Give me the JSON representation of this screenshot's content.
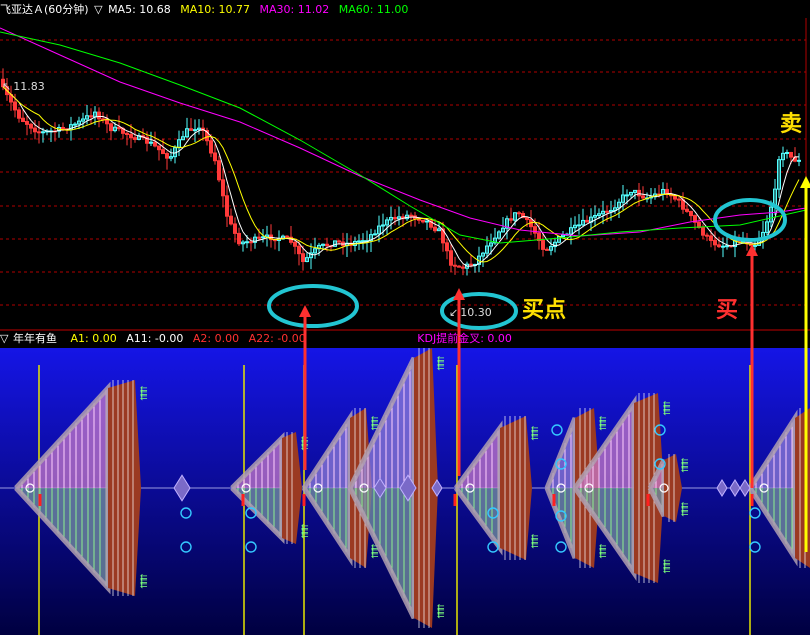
{
  "top_panel": {
    "symbol": "飞亚达Ａ(60分钟)",
    "toggle_icon": "triangle-down-icon",
    "ma_indicators": [
      {
        "label": "MA5: 10.68",
        "color": "#ffffff"
      },
      {
        "label": "MA10: 10.77",
        "color": "#ffff00"
      },
      {
        "label": "MA30: 11.02",
        "color": "#ff00ff"
      },
      {
        "label": "MA60: 11.00",
        "color": "#00ff00"
      }
    ],
    "high_label": "11.83",
    "low_label": "10.30"
  },
  "bottom_panel": {
    "title": "年年有鱼",
    "indicators": [
      {
        "label": "A1: 0.00",
        "color": "#ffff00"
      },
      {
        "label": "A11: -0.00",
        "color": "#ffffff"
      },
      {
        "label": "A2: 0.00",
        "color": "#ff3030"
      },
      {
        "label": "A22: -0.00",
        "color": "#ff3030"
      },
      {
        "label": "KDJ提前金叉: 0.00",
        "color": "#ff00ff"
      }
    ]
  },
  "annotations": {
    "buy_point": "买点",
    "buy": "买",
    "sell": "卖"
  },
  "colors": {
    "up_candle": "#54ffff",
    "down_candle": "#ff3a3a",
    "ma5": "#ffffff",
    "ma10": "#ffff00",
    "ma30": "#ff00ff",
    "ma60": "#00ff00",
    "grid": "#b00000",
    "circle_highlight": "#22c5d2",
    "arrow_buy": "#ff3030",
    "arrow_sell": "#ffff00",
    "indicator_bg_top": "#1515e6",
    "indicator_bg_bottom": "#000040"
  },
  "chart_data": [
    {
      "type": "candlestick",
      "title": "飞亚达Ａ(60分钟)",
      "ylim": [
        10.1,
        12.2
      ],
      "price_labels": [
        11.83,
        10.3
      ],
      "series": [
        {
          "name": "MA5",
          "last": 10.68
        },
        {
          "name": "MA10",
          "last": 10.77
        },
        {
          "name": "MA30",
          "last": 11.02
        },
        {
          "name": "MA60",
          "last": 11.0
        }
      ],
      "highlighted_lows": [
        10.44,
        10.3,
        10.56
      ],
      "signals": [
        "买点",
        "买",
        "卖"
      ]
    },
    {
      "type": "indicator",
      "title": "年年有鱼",
      "values": [
        {
          "name": "A1",
          "value": 0.0
        },
        {
          "name": "A11",
          "value": -0.0
        },
        {
          "name": "A2",
          "value": 0.0
        },
        {
          "name": "A22",
          "value": -0.0
        },
        {
          "name": "KDJ提前金叉",
          "value": 0.0
        }
      ]
    }
  ]
}
